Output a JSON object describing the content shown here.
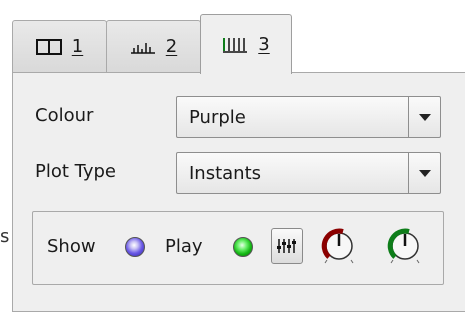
{
  "tabs": [
    {
      "icon": "grid-layout-icon",
      "label": "1",
      "active": false
    },
    {
      "icon": "bar-histogram-icon",
      "label": "2",
      "active": false
    },
    {
      "icon": "instants-ticks-icon",
      "label": "3",
      "active": true
    }
  ],
  "form": {
    "colour": {
      "label": "Colour",
      "value": "Purple"
    },
    "plot_type": {
      "label": "Plot Type",
      "value": "Instants"
    }
  },
  "controls": {
    "show_label": "Show",
    "play_label": "Play",
    "show_color": "#6a59e6",
    "play_color": "#14b814",
    "knob1_color": "#8b0000",
    "knob2_color": "#0e7d1a"
  },
  "edge_glyph": "s"
}
